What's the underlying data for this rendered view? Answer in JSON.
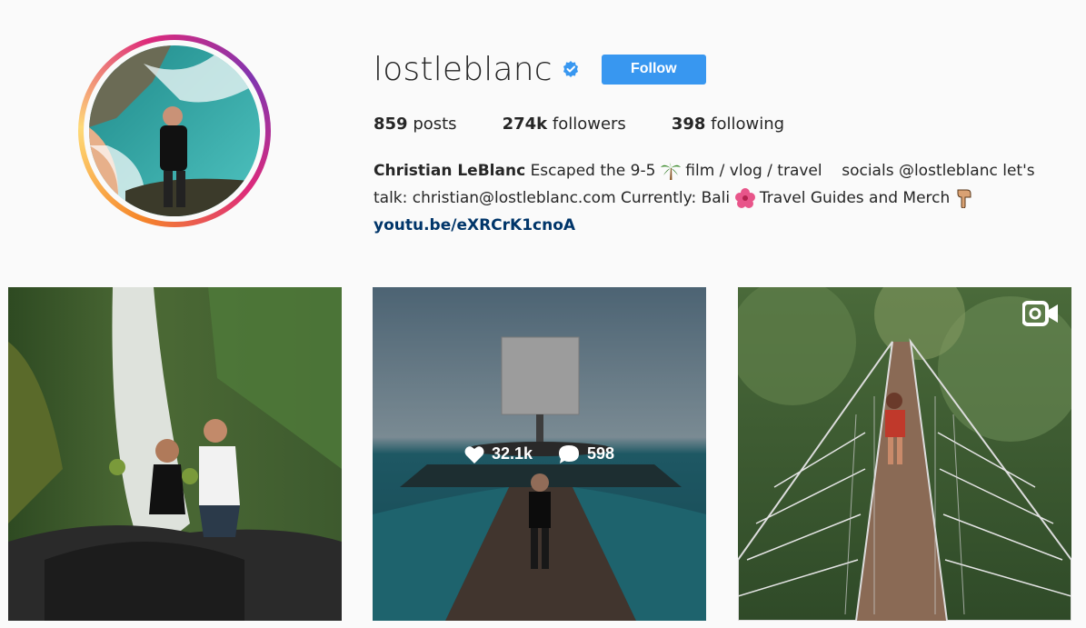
{
  "profile": {
    "username": "lostleblanc",
    "verified_icon": "verified-badge-icon",
    "follow_label": "Follow",
    "stats": {
      "posts_count": "859",
      "posts_label": "posts",
      "followers_count": "274k",
      "followers_label": "followers",
      "following_count": "398",
      "following_label": "following"
    },
    "bio": {
      "full_name": "Christian LeBlanc",
      "line1_text": "Escaped the 9-5",
      "line1_after_palm": "film / vlog / travel    socials @lostleblanc let's",
      "line2_text": "talk: christian@lostleblanc.com Currently: Bali",
      "line2_after_flower": "Travel Guides and Merch",
      "link": "youtu.be/eXRCrK1cnoA"
    }
  },
  "posts": [
    {
      "kind": "photo",
      "subject": "waterfall-couple"
    },
    {
      "kind": "photo",
      "subject": "pier-tower",
      "likes": "32.1k",
      "comments": "598",
      "hovered": true
    },
    {
      "kind": "video",
      "subject": "rope-bridge",
      "video_icon": "video-camera-icon"
    }
  ],
  "colors": {
    "accent": "#3897f0",
    "link": "#003569",
    "background": "#fafafa",
    "text": "#262626"
  }
}
